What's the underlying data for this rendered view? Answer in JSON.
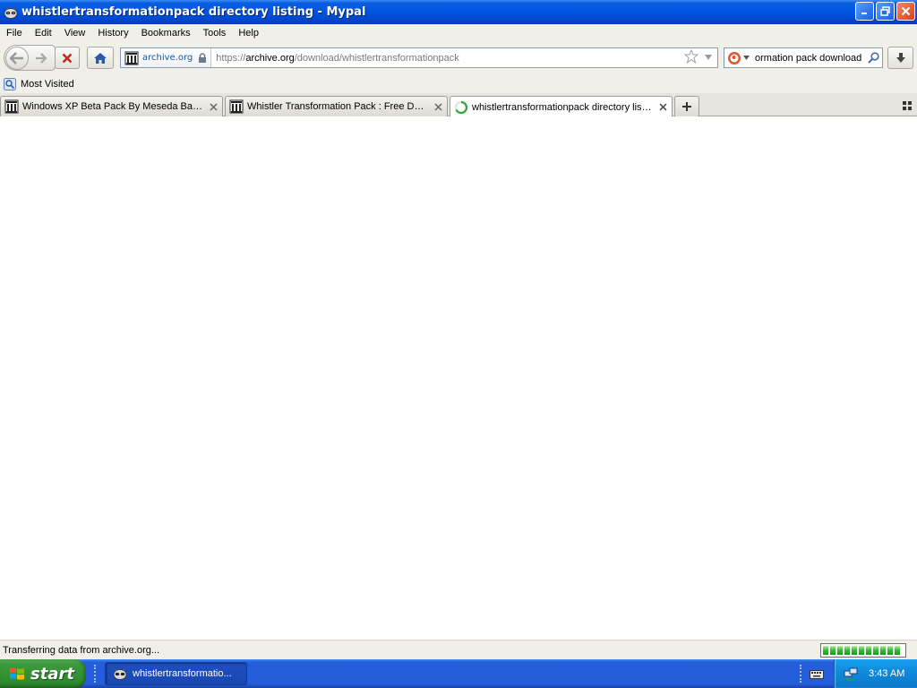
{
  "window": {
    "title": "whistlertransformationpack directory listing - Mypal",
    "app_icon": "mypal-raccoon-icon"
  },
  "menu": {
    "items": [
      "File",
      "Edit",
      "View",
      "History",
      "Bookmarks",
      "Tools",
      "Help"
    ]
  },
  "nav": {
    "identity_site": "archive.org",
    "url_prefix": "https://",
    "url_domain": "archive.org",
    "url_path": "/download/whistlertransformationpack",
    "search_text": "ormation pack download"
  },
  "bookmarks": {
    "items": [
      {
        "label": "Most Visited",
        "icon": "most-visited-icon"
      }
    ]
  },
  "tabs": [
    {
      "label": "Windows XP Beta Pack By Meseda Bagau...",
      "icon": "archive-org-icon",
      "active": false
    },
    {
      "label": "Whistler Transformation Pack : Free Dow...",
      "icon": "archive-org-icon",
      "active": false
    },
    {
      "label": "whistlertransformationpack directory listing",
      "icon": "loading-spinner-icon",
      "active": true
    }
  ],
  "status": {
    "text": "Transferring data from archive.org...",
    "progress_segments": 11,
    "progress_fraction": 0.9
  },
  "taskbar": {
    "start_label": "start",
    "task_label": "whistlertransformatio...",
    "clock": "3:43 AM"
  },
  "colors": {
    "titlebar": "#0054e3",
    "taskbar": "#245edb",
    "start_button": "#3c9a3c",
    "progress": "#2eb82e"
  }
}
